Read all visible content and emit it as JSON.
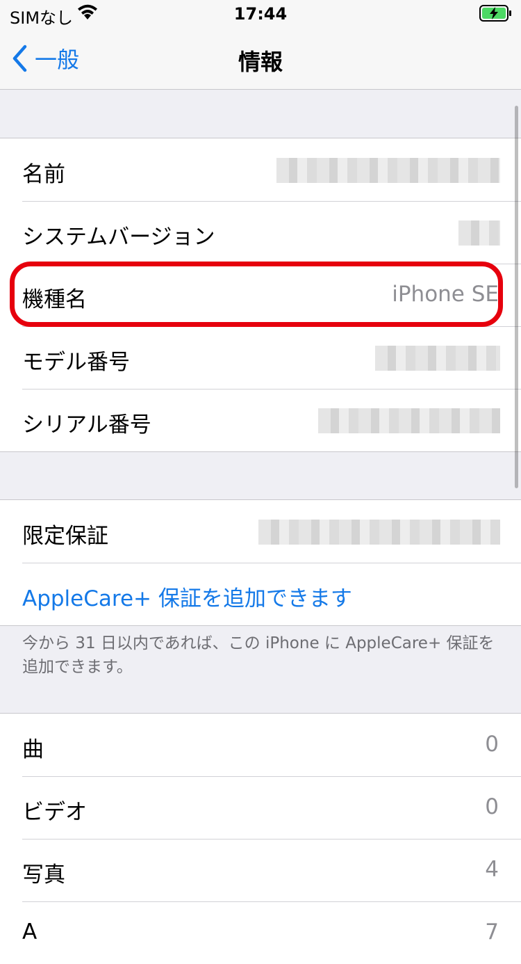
{
  "status_bar": {
    "carrier": "SIMなし",
    "time": "17:44"
  },
  "nav": {
    "back_label": "一般",
    "title": "情報"
  },
  "device_section": {
    "rows": [
      {
        "label": "名前",
        "value": ""
      },
      {
        "label": "システムバージョン",
        "value": ""
      },
      {
        "label": "機種名",
        "value": "iPhone SE"
      },
      {
        "label": "モデル番号",
        "value": ""
      },
      {
        "label": "シリアル番号",
        "value": ""
      }
    ]
  },
  "warranty_section": {
    "limited_warranty_label": "限定保証",
    "applecare_link": "AppleCare+ 保証を追加できます",
    "footer_note": "今から 31 日以内であれば、この iPhone に AppleCare+ 保証を追加できます。"
  },
  "media_section": {
    "rows": [
      {
        "label": "曲",
        "value": "0"
      },
      {
        "label": "ビデオ",
        "value": "0"
      },
      {
        "label": "写真",
        "value": "4"
      },
      {
        "label": "A",
        "value": "7"
      }
    ]
  },
  "colors": {
    "accent": "#1479e8",
    "highlight": "#e6000d",
    "background": "#efeff4"
  }
}
